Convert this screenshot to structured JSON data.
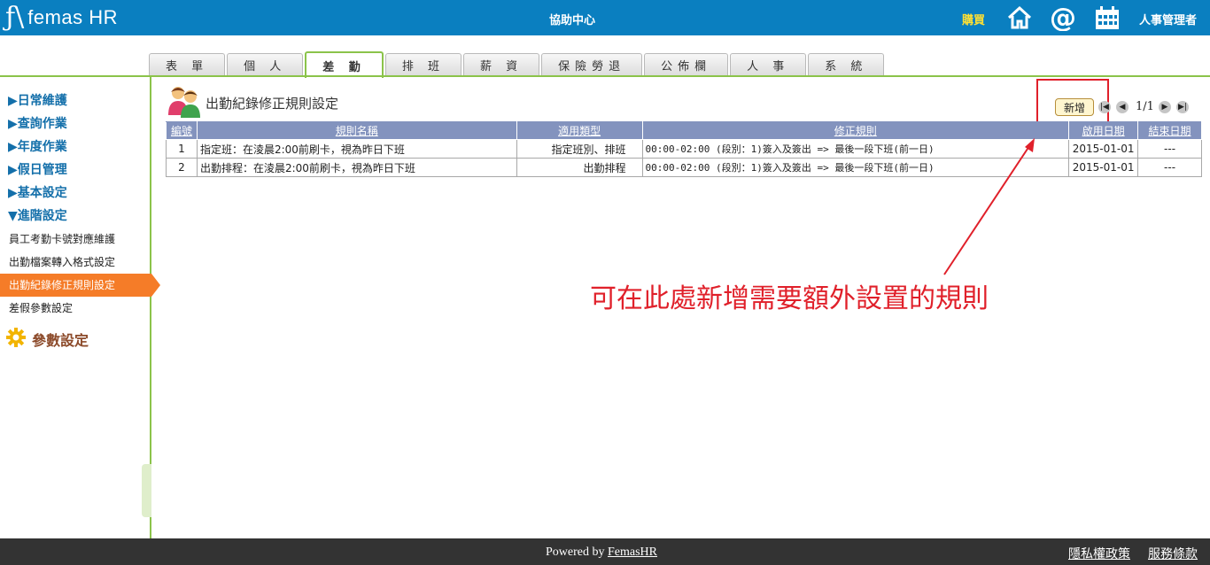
{
  "header": {
    "brand": "femas HR",
    "help_center": "協助中心",
    "buy": "購買",
    "user_role": "人事管理者",
    "colors": {
      "bar": "#0a7fc0",
      "buy": "#ffe033"
    }
  },
  "tabs": [
    "表 單",
    "個 人",
    "差 勤",
    "排 班",
    "薪 資",
    "保險勞退",
    "公佈欄",
    "人 事",
    "系 統"
  ],
  "active_tab": "差 勤",
  "sidebar": {
    "sections": [
      "▶日常維護",
      "▶查詢作業",
      "▶年度作業",
      "▶假日管理",
      "▶基本設定",
      "▼進階設定"
    ],
    "items": [
      "員工考勤卡號對應維護",
      "出勤檔案轉入格式設定",
      "出勤紀錄修正規則設定",
      "差假參數設定"
    ],
    "active_item": "出勤紀錄修正規則設定",
    "param_label": "參數設定",
    "colors": {
      "section": "#136faa",
      "active": "#f57c28",
      "accent": "#8bc34a"
    }
  },
  "main": {
    "title": "出勤紀錄修正規則設定",
    "add_button": "新增",
    "pager": "1/1",
    "table": {
      "headers": [
        "編號",
        "規則名稱",
        "適用類型",
        "修正規則",
        "啟用日期",
        "結束日期"
      ],
      "rows": [
        [
          "1",
          "指定班：在淩晨2:00前刷卡，視為昨日下班",
          "指定班別、排班",
          "00:00-02:00 (段別：1)簽入及簽出 => 最後一段下班(前一日)",
          "2015-01-01",
          "---"
        ],
        [
          "2",
          "出勤排程：在淩晨2:00前刷卡，視為昨日下班",
          "出勤排程",
          "00:00-02:00 (段別：1)簽入及簽出 => 最後一段下班(前一日)",
          "2015-01-01",
          "---"
        ]
      ]
    }
  },
  "annotation": "可在此處新增需要額外設置的規則",
  "footer": {
    "powered_prefix": "Powered by",
    "powered_link": "FemasHR",
    "privacy": "隱私權政策",
    "terms": "服務條款"
  }
}
